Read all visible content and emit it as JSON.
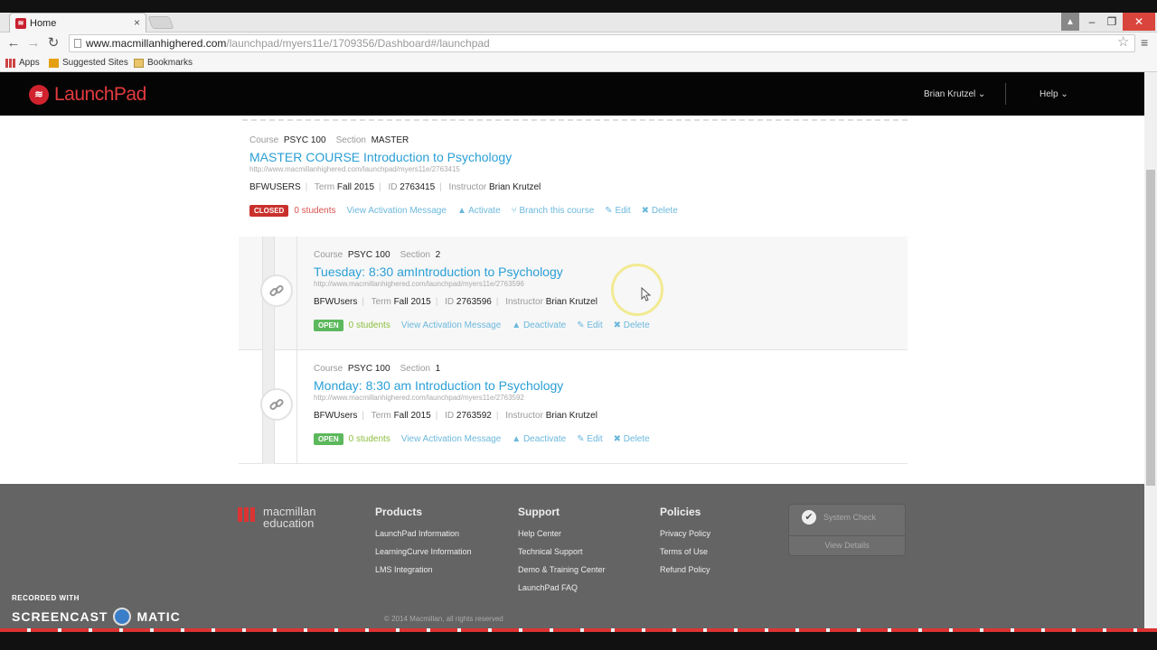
{
  "browser": {
    "tab_title": "Home",
    "url_host": "www.macmillanhighered.com",
    "url_path": "/launchpad/myers11e/1709356/Dashboard#/launchpad",
    "bookmarks": [
      "Apps",
      "Suggested Sites",
      "Bookmarks"
    ]
  },
  "header": {
    "logo": "LaunchPad",
    "user": "Brian Krutzel ⌄",
    "help": "Help ⌄"
  },
  "courses": [
    {
      "course_label": "Course",
      "course": "PSYC 100",
      "section_label": "Section",
      "section": "MASTER",
      "title": "MASTER COURSE Introduction to Psychology",
      "url": "http://www.macmillanhighered.com/launchpad/myers11e/2763415",
      "group": "BFWUSERS",
      "term_label": "Term",
      "term": "Fall 2015",
      "id_label": "ID",
      "id": "2763415",
      "instructor_label": "Instructor",
      "instructor": "Brian Krutzel",
      "status": "CLOSED",
      "students": "0 students",
      "actions": [
        "View Activation Message",
        "Activate",
        "Branch this course",
        "Edit",
        "Delete"
      ]
    },
    {
      "course_label": "Course",
      "course": "PSYC 100",
      "section_label": "Section",
      "section": "2",
      "title": "Tuesday: 8:30 amIntroduction to Psychology",
      "url": "http://www.macmillanhighered.com/launchpad/myers11e/2763596",
      "group": "BFWUsers",
      "term_label": "Term",
      "term": "Fall 2015",
      "id_label": "ID",
      "id": "2763596",
      "instructor_label": "Instructor",
      "instructor": "Brian Krutzel",
      "status": "OPEN",
      "students": "0 students",
      "actions": [
        "View Activation Message",
        "Deactivate",
        "Edit",
        "Delete"
      ]
    },
    {
      "course_label": "Course",
      "course": "PSYC 100",
      "section_label": "Section",
      "section": "1",
      "title": "Monday: 8:30 am Introduction to Psychology",
      "url": "http://www.macmillanhighered.com/launchpad/myers11e/2763592",
      "group": "BFWUsers",
      "term_label": "Term",
      "term": "Fall 2015",
      "id_label": "ID",
      "id": "2763592",
      "instructor_label": "Instructor",
      "instructor": "Brian Krutzel",
      "status": "OPEN",
      "students": "0 students",
      "actions": [
        "View Activation Message",
        "Deactivate",
        "Edit",
        "Delete"
      ]
    }
  ],
  "footer": {
    "logo_line1": "macmillan",
    "logo_line2": "education",
    "products": {
      "heading": "Products",
      "items": [
        "LaunchPad Information",
        "LearningCurve Information",
        "LMS Integration"
      ]
    },
    "support": {
      "heading": "Support",
      "items": [
        "Help Center",
        "Technical Support",
        "Demo & Training Center",
        "LaunchPad FAQ"
      ]
    },
    "policies": {
      "heading": "Policies",
      "items": [
        "Privacy Policy",
        "Terms of Use",
        "Refund Policy"
      ]
    },
    "system_check": "System Check",
    "view_details": "View Details",
    "copyright": "© 2014 Macmillan, all rights reserved"
  },
  "watermark": {
    "line1": "RECORDED WITH",
    "left": "SCREENCAST",
    "right": "MATIC"
  },
  "colors": {
    "link": "#2a9fd6",
    "closed": "#c9302c",
    "open": "#5cb85c",
    "brand": "#d0232d"
  }
}
